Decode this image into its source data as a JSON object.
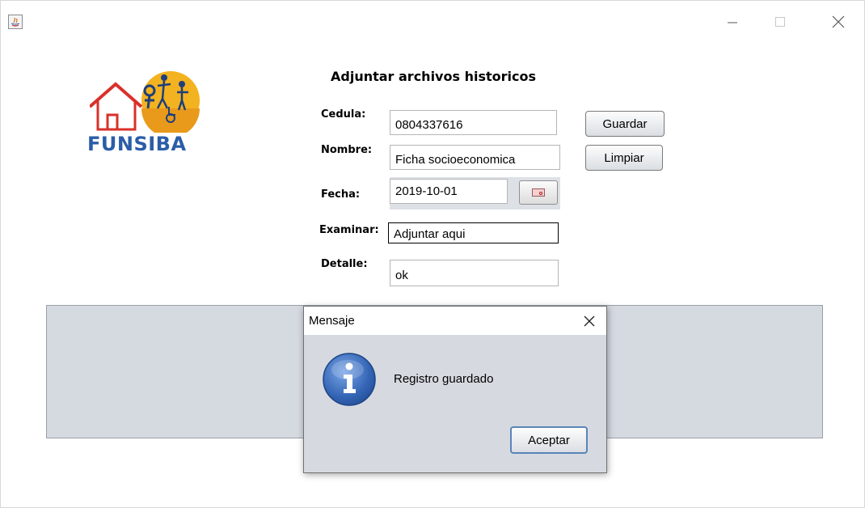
{
  "window": {
    "minimize_icon": "minimize-icon",
    "maximize_icon": "maximize-icon",
    "close_icon": "close-icon"
  },
  "logo": {
    "text": "FUNSIBA"
  },
  "form": {
    "title": "Adjuntar archivos historicos",
    "cedula_label": "Cedula:",
    "cedula_value": "0804337616",
    "nombre_label": "Nombre:",
    "nombre_value": "Ficha socioeconomica",
    "fecha_label": "Fecha:",
    "fecha_value": "2019-10-01",
    "examinar_label": "Examinar:",
    "examinar_value": "Adjuntar aqui",
    "detalle_label": "Detalle:",
    "detalle_value": "ok",
    "guardar_label": "Guardar",
    "limpiar_label": "Limpiar"
  },
  "dialog": {
    "title": "Mensaje",
    "message": "Registro guardado",
    "ok_label": "Aceptar",
    "icon": "info-icon"
  },
  "colors": {
    "logo_blue": "#2b5da8",
    "panel": "#d5d9e0",
    "dialog_bg": "#d6dae0",
    "info_icon": "#3b6fc0"
  }
}
